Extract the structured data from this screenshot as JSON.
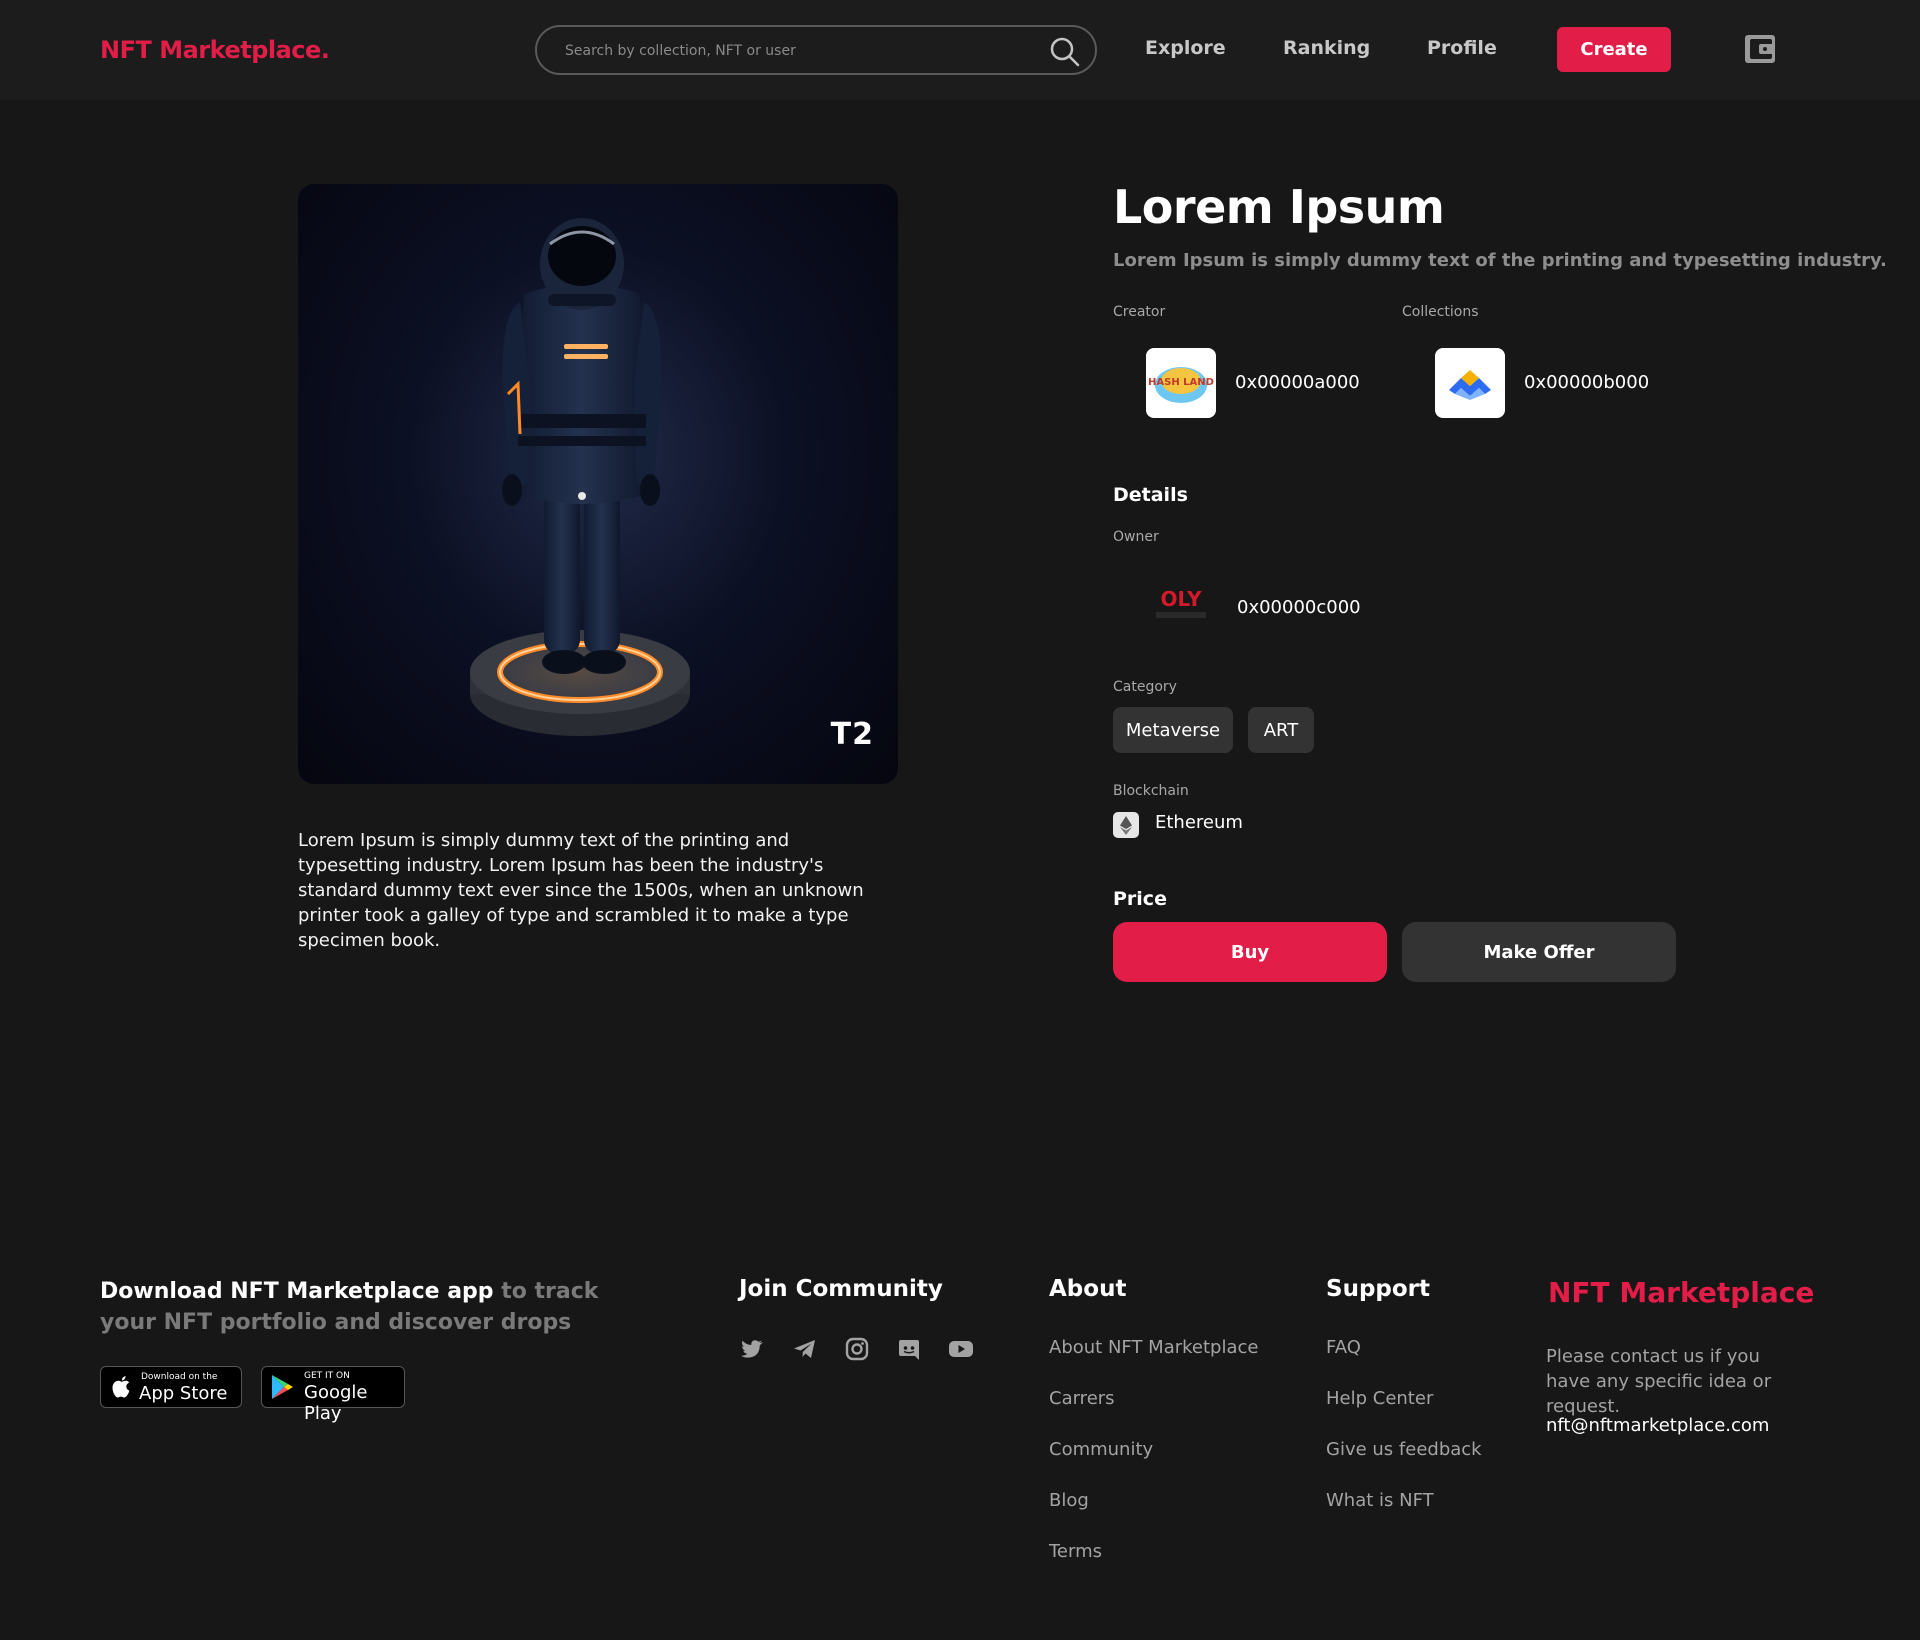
{
  "header": {
    "logo": "NFT Marketplace.",
    "search_placeholder": "Search by collection, NFT or user",
    "nav": [
      "Explore",
      "Ranking",
      "Profile"
    ],
    "create_label": "Create"
  },
  "artwork": {
    "tag": "T2",
    "description": "Lorem Ipsum is simply dummy text of the printing and typesetting industry. Lorem Ipsum has been the industry's standard dummy text ever since the 1500s, when an unknown printer took a galley of type and scrambled it to make a type specimen book."
  },
  "item": {
    "title": "Lorem Ipsum",
    "subtitle": "Lorem Ipsum is simply dummy text of the printing and typesetting industry.",
    "creator_label": "Creator",
    "creator_address": "0x00000a000",
    "creator_logo_text": "HASH LAND",
    "collections_label": "Collections",
    "collection_address": "0x00000b000",
    "details_heading": "Details",
    "owner_label": "Owner",
    "owner_address": "0x00000c000",
    "owner_logo_text": "OLY",
    "category_label": "Category",
    "categories": [
      "Metaverse",
      "ART"
    ],
    "blockchain_label": "Blockchain",
    "blockchain": "Ethereum",
    "price_heading": "Price",
    "buy_label": "Buy",
    "offer_label": "Make Offer"
  },
  "footer": {
    "app_title_bold": "Download NFT Marketplace app",
    "app_title_rest": " to track your NFT portfolio and discover drops",
    "app_store_small": "Download on the",
    "app_store_big": "App Store",
    "google_small": "GET IT ON",
    "google_big": "Google Play",
    "community_heading": "Join Community",
    "social_icons": [
      "twitter-icon",
      "telegram-icon",
      "instagram-icon",
      "discord-icon",
      "youtube-icon"
    ],
    "about_heading": "About",
    "about_links": [
      "About NFT Marketplace",
      "Carrers",
      "Community",
      "Blog",
      "Terms"
    ],
    "support_heading": "Support",
    "support_links": [
      "FAQ",
      "Help Center",
      "Give us feedback",
      "What is NFT"
    ],
    "brand": "NFT Marketplace",
    "contact_text": "Please contact us if you have any specific idea or request.",
    "email": "nft@nftmarketplace.com"
  },
  "colors": {
    "accent": "#e11d48",
    "background": "#171717",
    "header_bg": "#1c1c1c",
    "chip_bg": "#333333",
    "muted_text": "#8e8e8e"
  }
}
